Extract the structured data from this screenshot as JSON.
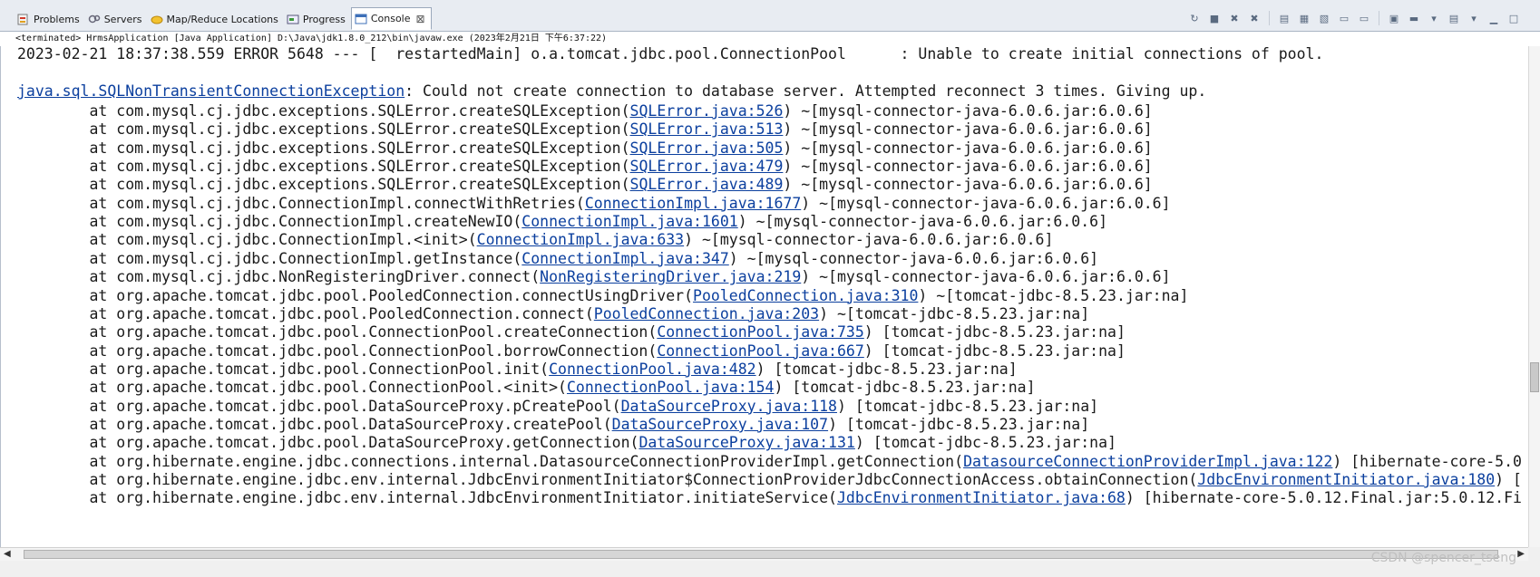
{
  "tabs": [
    {
      "label": "Problems",
      "icon": "problems-icon"
    },
    {
      "label": "Servers",
      "icon": "servers-icon"
    },
    {
      "label": "Map/Reduce Locations",
      "icon": "map-reduce-icon"
    },
    {
      "label": "Progress",
      "icon": "progress-icon"
    },
    {
      "label": "Console",
      "icon": "console-icon",
      "active": true
    }
  ],
  "status": "<terminated> HrmsApplication [Java Application] D:\\Java\\jdk1.8.0_212\\bin\\javaw.exe (2023年2月21日 下午6:37:22)",
  "watermark": "CSDN @spencer_tseng",
  "console": {
    "error_line": "2023-02-21 18:37:38.559 ERROR 5648 --- [  restartedMain] o.a.tomcat.jdbc.pool.ConnectionPool      : Unable to create initial connections of pool.",
    "exception": {
      "link": "java.sql.SQLNonTransientConnectionException",
      "message": ": Could not create connection to database server. Attempted reconnect 3 times. Giving up."
    },
    "frames": [
      {
        "pre": "        at com.mysql.cj.jdbc.exceptions.SQLError.createSQLException(",
        "link": "SQLError.java:526",
        "post": ") ~[mysql-connector-java-6.0.6.jar:6.0.6]"
      },
      {
        "pre": "        at com.mysql.cj.jdbc.exceptions.SQLError.createSQLException(",
        "link": "SQLError.java:513",
        "post": ") ~[mysql-connector-java-6.0.6.jar:6.0.6]"
      },
      {
        "pre": "        at com.mysql.cj.jdbc.exceptions.SQLError.createSQLException(",
        "link": "SQLError.java:505",
        "post": ") ~[mysql-connector-java-6.0.6.jar:6.0.6]"
      },
      {
        "pre": "        at com.mysql.cj.jdbc.exceptions.SQLError.createSQLException(",
        "link": "SQLError.java:479",
        "post": ") ~[mysql-connector-java-6.0.6.jar:6.0.6]"
      },
      {
        "pre": "        at com.mysql.cj.jdbc.exceptions.SQLError.createSQLException(",
        "link": "SQLError.java:489",
        "post": ") ~[mysql-connector-java-6.0.6.jar:6.0.6]"
      },
      {
        "pre": "        at com.mysql.cj.jdbc.ConnectionImpl.connectWithRetries(",
        "link": "ConnectionImpl.java:1677",
        "post": ") ~[mysql-connector-java-6.0.6.jar:6.0.6]"
      },
      {
        "pre": "        at com.mysql.cj.jdbc.ConnectionImpl.createNewIO(",
        "link": "ConnectionImpl.java:1601",
        "post": ") ~[mysql-connector-java-6.0.6.jar:6.0.6]"
      },
      {
        "pre": "        at com.mysql.cj.jdbc.ConnectionImpl.<init>(",
        "link": "ConnectionImpl.java:633",
        "post": ") ~[mysql-connector-java-6.0.6.jar:6.0.6]"
      },
      {
        "pre": "        at com.mysql.cj.jdbc.ConnectionImpl.getInstance(",
        "link": "ConnectionImpl.java:347",
        "post": ") ~[mysql-connector-java-6.0.6.jar:6.0.6]"
      },
      {
        "pre": "        at com.mysql.cj.jdbc.NonRegisteringDriver.connect(",
        "link": "NonRegisteringDriver.java:219",
        "post": ") ~[mysql-connector-java-6.0.6.jar:6.0.6]"
      },
      {
        "pre": "        at org.apache.tomcat.jdbc.pool.PooledConnection.connectUsingDriver(",
        "link": "PooledConnection.java:310",
        "post": ") ~[tomcat-jdbc-8.5.23.jar:na]"
      },
      {
        "pre": "        at org.apache.tomcat.jdbc.pool.PooledConnection.connect(",
        "link": "PooledConnection.java:203",
        "post": ") ~[tomcat-jdbc-8.5.23.jar:na]"
      },
      {
        "pre": "        at org.apache.tomcat.jdbc.pool.ConnectionPool.createConnection(",
        "link": "ConnectionPool.java:735",
        "post": ") [tomcat-jdbc-8.5.23.jar:na]"
      },
      {
        "pre": "        at org.apache.tomcat.jdbc.pool.ConnectionPool.borrowConnection(",
        "link": "ConnectionPool.java:667",
        "post": ") [tomcat-jdbc-8.5.23.jar:na]"
      },
      {
        "pre": "        at org.apache.tomcat.jdbc.pool.ConnectionPool.init(",
        "link": "ConnectionPool.java:482",
        "post": ") [tomcat-jdbc-8.5.23.jar:na]"
      },
      {
        "pre": "        at org.apache.tomcat.jdbc.pool.ConnectionPool.<init>(",
        "link": "ConnectionPool.java:154",
        "post": ") [tomcat-jdbc-8.5.23.jar:na]"
      },
      {
        "pre": "        at org.apache.tomcat.jdbc.pool.DataSourceProxy.pCreatePool(",
        "link": "DataSourceProxy.java:118",
        "post": ") [tomcat-jdbc-8.5.23.jar:na]"
      },
      {
        "pre": "        at org.apache.tomcat.jdbc.pool.DataSourceProxy.createPool(",
        "link": "DataSourceProxy.java:107",
        "post": ") [tomcat-jdbc-8.5.23.jar:na]"
      },
      {
        "pre": "        at org.apache.tomcat.jdbc.pool.DataSourceProxy.getConnection(",
        "link": "DataSourceProxy.java:131",
        "post": ") [tomcat-jdbc-8.5.23.jar:na]"
      },
      {
        "pre": "        at org.hibernate.engine.jdbc.connections.internal.DatasourceConnectionProviderImpl.getConnection(",
        "link": "DatasourceConnectionProviderImpl.java:122",
        "post": ") [hibernate-core-5.0"
      },
      {
        "pre": "        at org.hibernate.engine.jdbc.env.internal.JdbcEnvironmentInitiator$ConnectionProviderJdbcConnectionAccess.obtainConnection(",
        "link": "JdbcEnvironmentInitiator.java:180",
        "post": ") ["
      },
      {
        "pre": "        at org.hibernate.engine.jdbc.env.internal.JdbcEnvironmentInitiator.initiateService(",
        "link": "JdbcEnvironmentInitiator.java:68",
        "post": ") [hibernate-core-5.0.12.Final.jar:5.0.12.Fi"
      }
    ]
  }
}
